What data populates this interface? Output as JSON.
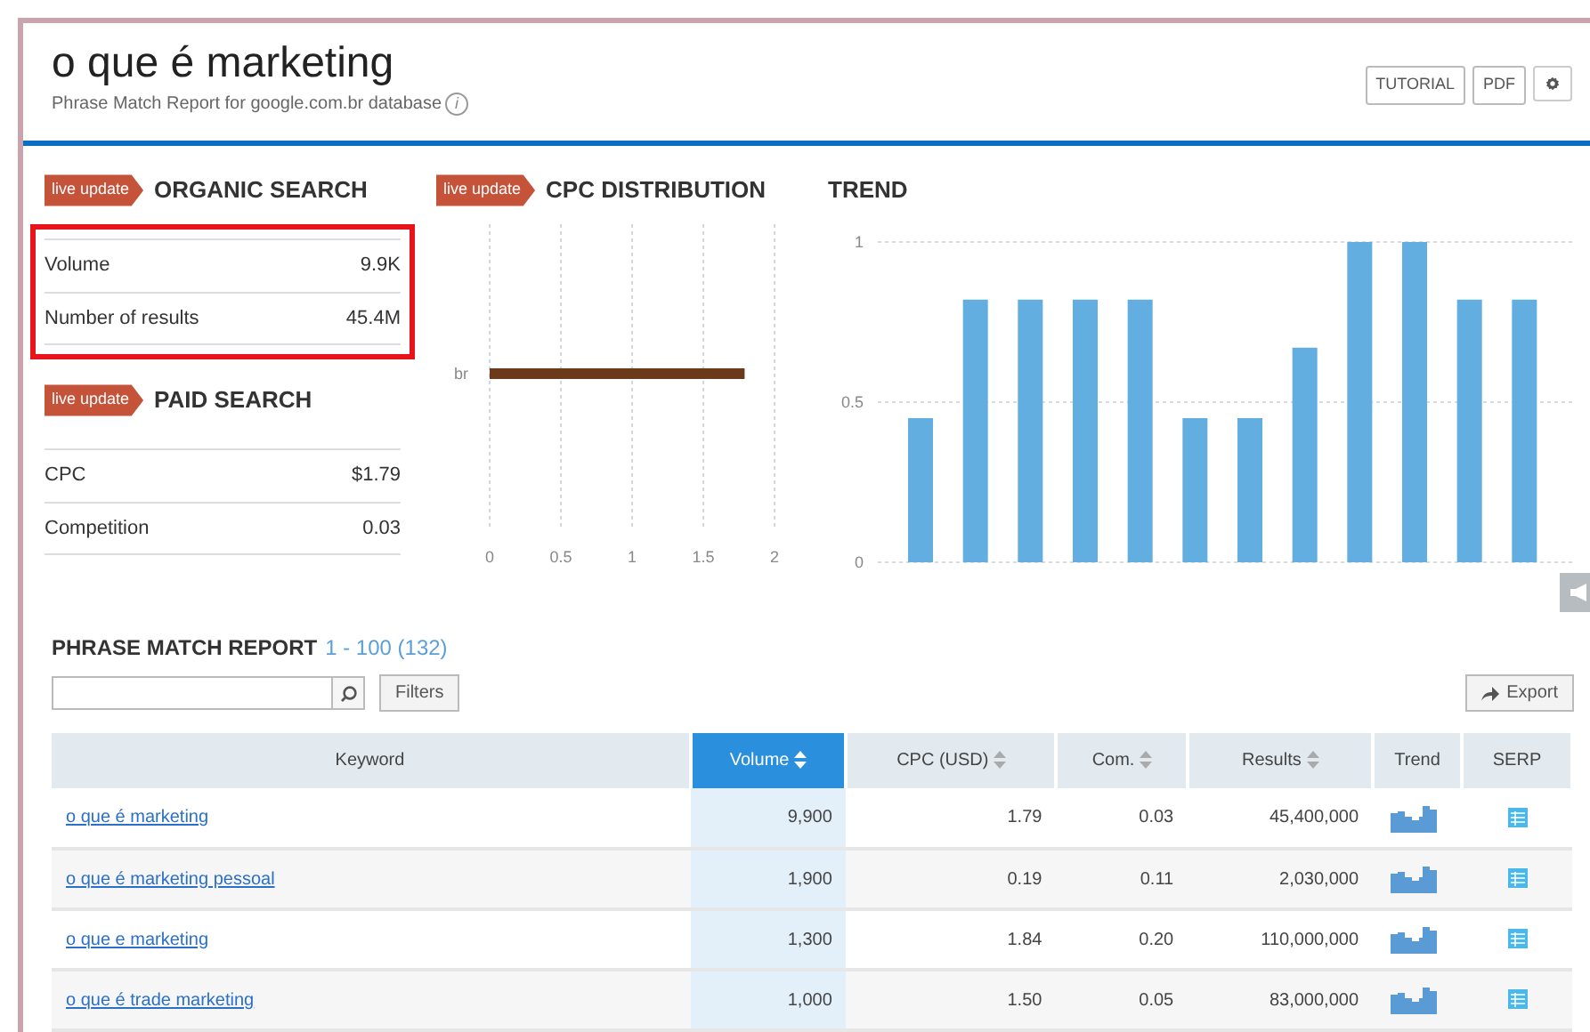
{
  "header": {
    "title": "o que é marketing",
    "subtitle": "Phrase Match Report for google.com.br database",
    "info_icon": "i",
    "buttons": [
      "TUTORIAL",
      "PDF"
    ]
  },
  "organic_search": {
    "badge": "live update",
    "title": "ORGANIC SEARCH",
    "highlighted": true,
    "metrics": [
      {
        "label": "Volume",
        "value": "9.9K"
      },
      {
        "label": "Number of results",
        "value": "45.4M"
      }
    ]
  },
  "paid_search": {
    "badge": "live update",
    "title": "PAID SEARCH",
    "metrics": [
      {
        "label": "CPC",
        "value": "$1.79"
      },
      {
        "label": "Competition",
        "value": "0.03"
      }
    ]
  },
  "cpc_distribution": {
    "badge": "live update",
    "title": "CPC DISTRIBUTION",
    "chart_data": {
      "type": "bar",
      "orientation": "horizontal",
      "categories": [
        "br"
      ],
      "series": [
        {
          "color": "#6b3a1a",
          "values": [
            1.79
          ]
        }
      ],
      "grid": true,
      "xlim": [
        0,
        2
      ],
      "xticks": [
        {
          "value": 0,
          "label": "0"
        },
        {
          "value": 0.5,
          "label": "0.5"
        },
        {
          "value": 1,
          "label": "1"
        },
        {
          "value": 1.5,
          "label": "1.5"
        },
        {
          "value": 2,
          "label": "2"
        }
      ]
    }
  },
  "trend": {
    "title": "TREND",
    "chart_data": {
      "type": "bar",
      "grid": true,
      "series": [
        {
          "color": "#62aee0",
          "values": [
            0.45,
            0.82,
            0.82,
            0.82,
            0.82,
            0.45,
            0.45,
            0.67,
            1,
            1,
            0.82,
            0.82
          ]
        }
      ],
      "ylim": [
        0,
        1
      ],
      "yticks": [
        {
          "value": 0,
          "label": "0"
        },
        {
          "value": 0.5,
          "label": "0.5"
        },
        {
          "value": 1,
          "label": "1"
        }
      ]
    }
  },
  "phrase_match": {
    "title": "PHRASE MATCH REPORT",
    "range": "1 - 100 (132)",
    "filters_button": "Filters",
    "export_button": "Export",
    "columns": [
      {
        "label": "Keyword",
        "sortable": false,
        "selected": false
      },
      {
        "label": "Volume",
        "sortable": true,
        "selected": true
      },
      {
        "label": "CPC (USD)",
        "sortable": true,
        "selected": false
      },
      {
        "label": "Com.",
        "sortable": true,
        "selected": false
      },
      {
        "label": "Results",
        "sortable": true,
        "selected": false
      },
      {
        "label": "Trend",
        "sortable": false,
        "selected": false
      },
      {
        "label": "SERP",
        "sortable": false,
        "selected": false
      }
    ],
    "rows": [
      {
        "keyword": "o que é marketing",
        "volume": "9,900",
        "cpc": "1.79",
        "com": "0.03",
        "results": "45,400,000"
      },
      {
        "keyword": "o que é marketing pessoal",
        "volume": "1,900",
        "cpc": "0.19",
        "com": "0.11",
        "results": "2,030,000"
      },
      {
        "keyword": "o que e marketing",
        "volume": "1,300",
        "cpc": "1.84",
        "com": "0.20",
        "results": "110,000,000"
      },
      {
        "keyword": "o que é trade marketing",
        "volume": "1,000",
        "cpc": "1.50",
        "com": "0.05",
        "results": "83,000,000"
      }
    ]
  }
}
